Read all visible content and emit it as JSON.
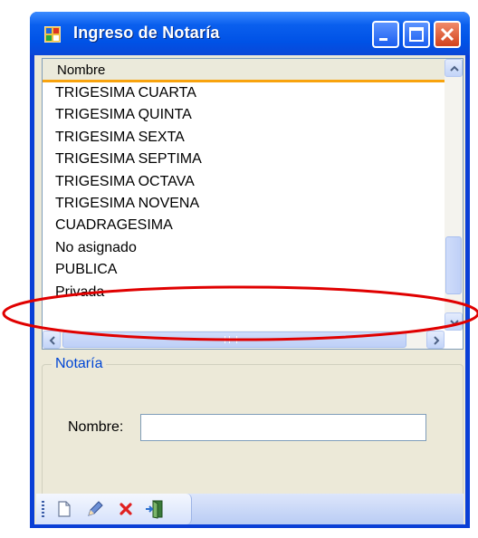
{
  "window": {
    "title": "Ingreso de Notaría"
  },
  "grid": {
    "column_header": "Nombre",
    "rows": [
      "TRIGESIMA CUARTA",
      "TRIGESIMA QUINTA",
      "TRIGESIMA SEXTA",
      "TRIGESIMA SEPTIMA",
      "TRIGESIMA OCTAVA",
      "TRIGESIMA NOVENA",
      "CUADRAGESIMA",
      "No asignado",
      "PUBLICA",
      "Privada"
    ]
  },
  "group": {
    "legend": "Notaría",
    "nombre_label": "Nombre:",
    "nombre_value": ""
  },
  "icons": {
    "app": "form-icon",
    "new": "new-document-icon",
    "edit": "pencil-icon",
    "delete": "delete-x-icon",
    "exit": "exit-door-icon"
  },
  "colors": {
    "titlebar": "#0a5fee",
    "header_underline": "#f8a30e",
    "highlight_ellipse": "#e00000",
    "legend_text": "#0046d5"
  }
}
